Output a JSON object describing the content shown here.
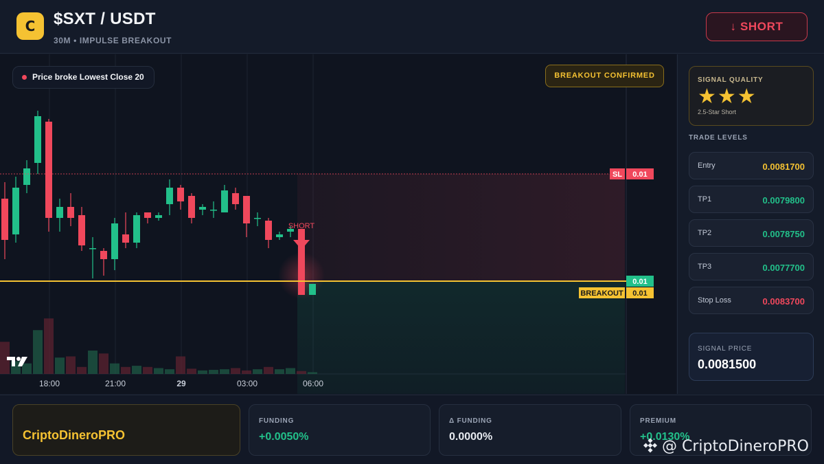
{
  "header": {
    "logo_letter": "C",
    "pair": "$SXT / USDT",
    "subtitle": "30M • IMPULSE BREAKOUT",
    "direction_button": "↓ SHORT"
  },
  "chart": {
    "info_pill": "Price broke Lowest Close 20",
    "confirm_badge": "BREAKOUT CONFIRMED",
    "short_label": "SHORT",
    "tv_logo": "TV",
    "price_tags": {
      "sl_label": "SL",
      "sl_value": "0.01",
      "price_value": "0.01",
      "breakout_label": "BREAKOUT",
      "breakout_value": "0.01"
    },
    "time_ticks": [
      "18:00",
      "21:00",
      "29",
      "03:00",
      "06:00"
    ],
    "colors": {
      "up": "#22c08a",
      "down": "#f0485c",
      "breakout_line": "#f5c232",
      "sl_line": "#f0485c"
    }
  },
  "chart_data": {
    "type": "candlestick",
    "x_ticks": [
      "18:00",
      "21:00",
      "29",
      "03:00",
      "06:00"
    ],
    "candles": [
      {
        "o": 0.00804,
        "h": 0.0081,
        "l": 0.00782,
        "c": 0.00789
      },
      {
        "o": 0.00791,
        "h": 0.00812,
        "l": 0.00788,
        "c": 0.00808
      },
      {
        "o": 0.00809,
        "h": 0.00818,
        "l": 0.00806,
        "c": 0.00815
      },
      {
        "o": 0.00817,
        "h": 0.00836,
        "l": 0.00813,
        "c": 0.00834
      },
      {
        "o": 0.00832,
        "h": 0.00833,
        "l": 0.00792,
        "c": 0.00797
      },
      {
        "o": 0.00797,
        "h": 0.00804,
        "l": 0.00792,
        "c": 0.00801
      },
      {
        "o": 0.00801,
        "h": 0.00806,
        "l": 0.00794,
        "c": 0.00797
      },
      {
        "o": 0.00798,
        "h": 0.00801,
        "l": 0.00785,
        "c": 0.00787
      },
      {
        "o": 0.00786,
        "h": 0.0079,
        "l": 0.00775,
        "c": 0.00786
      },
      {
        "o": 0.00785,
        "h": 0.00786,
        "l": 0.00776,
        "c": 0.00782
      },
      {
        "o": 0.00782,
        "h": 0.00797,
        "l": 0.00778,
        "c": 0.00795
      },
      {
        "o": 0.00791,
        "h": 0.00799,
        "l": 0.00786,
        "c": 0.00788
      },
      {
        "o": 0.00788,
        "h": 0.00799,
        "l": 0.00786,
        "c": 0.00798
      },
      {
        "o": 0.00799,
        "h": 0.00799,
        "l": 0.00795,
        "c": 0.00797
      },
      {
        "o": 0.00797,
        "h": 0.00799,
        "l": 0.00796,
        "c": 0.00798
      },
      {
        "o": 0.00802,
        "h": 0.00811,
        "l": 0.00798,
        "c": 0.00808
      },
      {
        "o": 0.00808,
        "h": 0.00809,
        "l": 0.008,
        "c": 0.00803
      },
      {
        "o": 0.00805,
        "h": 0.00806,
        "l": 0.00795,
        "c": 0.00797
      },
      {
        "o": 0.008,
        "h": 0.00802,
        "l": 0.00798,
        "c": 0.00801
      },
      {
        "o": 0.008,
        "h": 0.00803,
        "l": 0.00797,
        "c": 0.008
      },
      {
        "o": 0.00799,
        "h": 0.00809,
        "l": 0.00799,
        "c": 0.00807
      },
      {
        "o": 0.00806,
        "h": 0.00808,
        "l": 0.008,
        "c": 0.00802
      },
      {
        "o": 0.00805,
        "h": 0.00805,
        "l": 0.0079,
        "c": 0.00795
      },
      {
        "o": 0.00797,
        "h": 0.00799,
        "l": 0.00794,
        "c": 0.00797
      },
      {
        "o": 0.00796,
        "h": 0.00797,
        "l": 0.00786,
        "c": 0.00789
      },
      {
        "o": 0.0079,
        "h": 0.00792,
        "l": 0.00789,
        "c": 0.00791
      },
      {
        "o": 0.00792,
        "h": 0.00794,
        "l": 0.0079,
        "c": 0.00793
      },
      {
        "o": 0.00793,
        "h": 0.00793,
        "l": 0.00769,
        "c": 0.00769
      },
      {
        "o": 0.00769,
        "h": 0.00773,
        "l": 0.00769,
        "c": 0.00773
      }
    ],
    "volumes": [
      0.55,
      0.22,
      0.18,
      0.75,
      0.95,
      0.28,
      0.3,
      0.12,
      0.4,
      0.35,
      0.18,
      0.12,
      0.14,
      0.12,
      0.1,
      0.08,
      0.3,
      0.09,
      0.06,
      0.07,
      0.08,
      0.1,
      0.06,
      0.08,
      0.12,
      0.08,
      0.1,
      0.05,
      0.03
    ],
    "levels": {
      "sl": 0.00813,
      "breakout": 0.00774
    }
  },
  "sidebar": {
    "signal_quality_title": "SIGNAL QUALITY",
    "stars": "★★★",
    "signal_quality_sub": "2.5-Star Short",
    "trade_levels_title": "TRADE LEVELS",
    "levels": [
      {
        "label": "Entry",
        "value": "0.0081700",
        "color": "#f5c232"
      },
      {
        "label": "TP1",
        "value": "0.0079800",
        "color": "#22c08a"
      },
      {
        "label": "TP2",
        "value": "0.0078750",
        "color": "#22c08a"
      },
      {
        "label": "TP3",
        "value": "0.0077700",
        "color": "#22c08a"
      },
      {
        "label": "Stop Loss",
        "value": "0.0083700",
        "color": "#f0485c"
      }
    ],
    "signal_price_title": "SIGNAL PRICE",
    "signal_price_value": "0.0081500"
  },
  "footer": {
    "brand": "CriptoDineroPRO",
    "stats": [
      {
        "title": "FUNDING",
        "value": "+0.0050%",
        "color": "#22c08a"
      },
      {
        "title": "Δ FUNDING",
        "value": "0.0000%",
        "color": "#e6e9ef"
      },
      {
        "title": "PREMIUM",
        "value": "+0.0130%",
        "color": "#22c08a"
      }
    ],
    "watermark": "@ CriptoDineroPRO"
  }
}
